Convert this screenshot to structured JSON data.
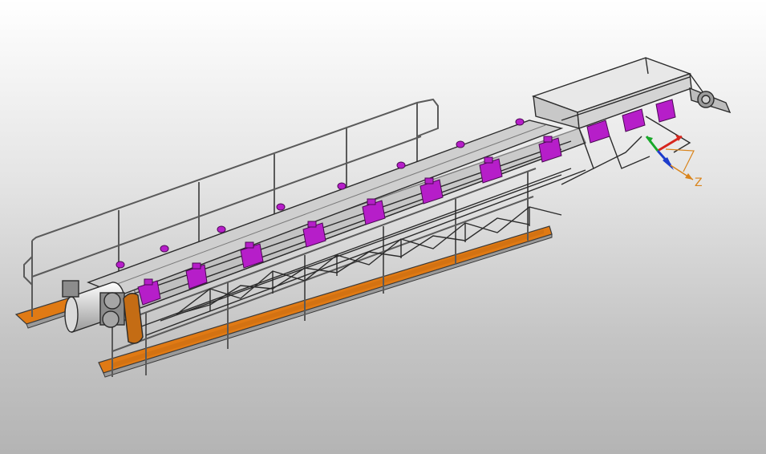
{
  "viewer": {
    "model": "belt-conveyor-assembly",
    "accent_colors": {
      "walkway_deck": "#e07a14",
      "idler_brackets": "#b61ec9",
      "frame_steel": "#a9a9a9",
      "frame_edges": "#2b2b2b"
    },
    "triad": {
      "axis_label": "Z",
      "axis_colors": {
        "x": "#d7261e",
        "y": "#19a82a",
        "z": "#1d3ccc",
        "z_arrow": "#d9841c"
      }
    }
  }
}
